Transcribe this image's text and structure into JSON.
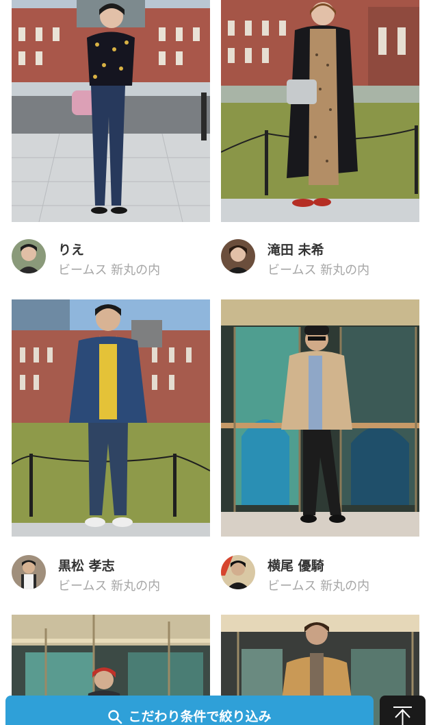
{
  "staff_cards": [
    {
      "name": "りえ",
      "shop": "ビームス 新丸の内"
    },
    {
      "name": "滝田 未希",
      "shop": "ビームス 新丸の内"
    },
    {
      "name": "黒松 孝志",
      "shop": "ビームス 新丸の内"
    },
    {
      "name": "横尾 優騎",
      "shop": "ビームス 新丸の内"
    }
  ],
  "filter_button": {
    "label": "こだわり条件で絞り込み",
    "icon": "search-icon"
  },
  "scroll_top_button": {
    "icon": "arrow-up-icon"
  },
  "colors": {
    "accent": "#2fa0d8",
    "name_text": "#333333",
    "shop_text": "#a6a6a6",
    "scroll_top_bg": "#1a1a1a"
  }
}
